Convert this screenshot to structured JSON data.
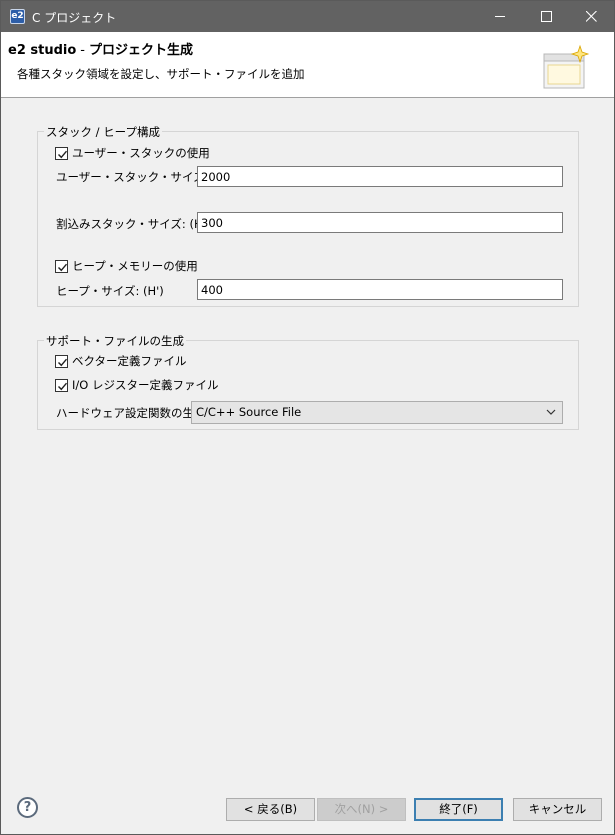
{
  "window": {
    "title": "C プロジェクト",
    "app_icon_text": "e2"
  },
  "banner": {
    "title_product": "e2 studio",
    "title_separator": "-",
    "title_page": "プロジェクト生成",
    "description": "各種スタック領域を設定し、サポート・ファイルを追加"
  },
  "stack_group": {
    "legend": "スタック / ヒープ構成",
    "use_user_stack": {
      "label": "ユーザー・スタックの使用",
      "checked": true
    },
    "user_stack_size": {
      "label": "ユーザー・スタック・サイズ: (H')",
      "value": "2000"
    },
    "interrupt_stack_size": {
      "label": "割込みスタック・サイズ: (H')",
      "value": "300"
    },
    "use_heap": {
      "label": "ヒープ・メモリーの使用",
      "checked": true
    },
    "heap_size": {
      "label": "ヒープ・サイズ: (H')",
      "value": "400"
    }
  },
  "support_group": {
    "legend": "サポート・ファイルの生成",
    "vector_def": {
      "label": "ベクター定義ファイル",
      "checked": true
    },
    "io_register_def": {
      "label": "I/O レジスター定義ファイル",
      "checked": true
    },
    "hw_init_func": {
      "label": "ハードウェア設定関数の生成",
      "selected": "C/C++ Source File"
    }
  },
  "footer": {
    "help_icon": "help-icon",
    "help_glyph": "?",
    "back_label": "< 戻る(B)",
    "next_label": "次へ(N) >",
    "finish_label": "終了(F)",
    "cancel_label": "キャンセル"
  }
}
